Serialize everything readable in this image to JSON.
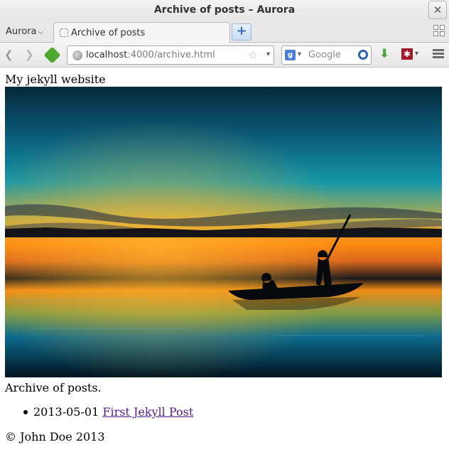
{
  "window": {
    "title": "Archive of posts – Aurora",
    "close_glyph": "✕"
  },
  "tabbar": {
    "app_menu_label": "Aurora",
    "active_tab_label": "Archive of posts",
    "new_tab_glyph": "+"
  },
  "navbar": {
    "url_host": "localhost",
    "url_path": ":4000/archive.html",
    "search_placeholder": "Google",
    "search_engine_glyph": "g",
    "addon_glyph": "✱",
    "icons": [
      "back-icon",
      "forward-icon",
      "home-icon",
      "globe-icon",
      "bookmark-star-icon",
      "search-engine-icon",
      "magnifier-icon",
      "download-icon",
      "addon-icon",
      "menu-icon",
      "tab-groups-icon"
    ]
  },
  "page": {
    "site_title": "My jekyll website",
    "archive_heading": "Archive of posts.",
    "posts": [
      {
        "date": "2013-05-01",
        "title": "First Jekyll Post"
      }
    ],
    "footer": "© John Doe 2013"
  },
  "colors": {
    "link_visited": "#551a8b",
    "newtab_accent": "#2f6fb7",
    "home_green": "#4fa62f",
    "download_green": "#4ea83a",
    "addon_red": "#a5162b"
  }
}
